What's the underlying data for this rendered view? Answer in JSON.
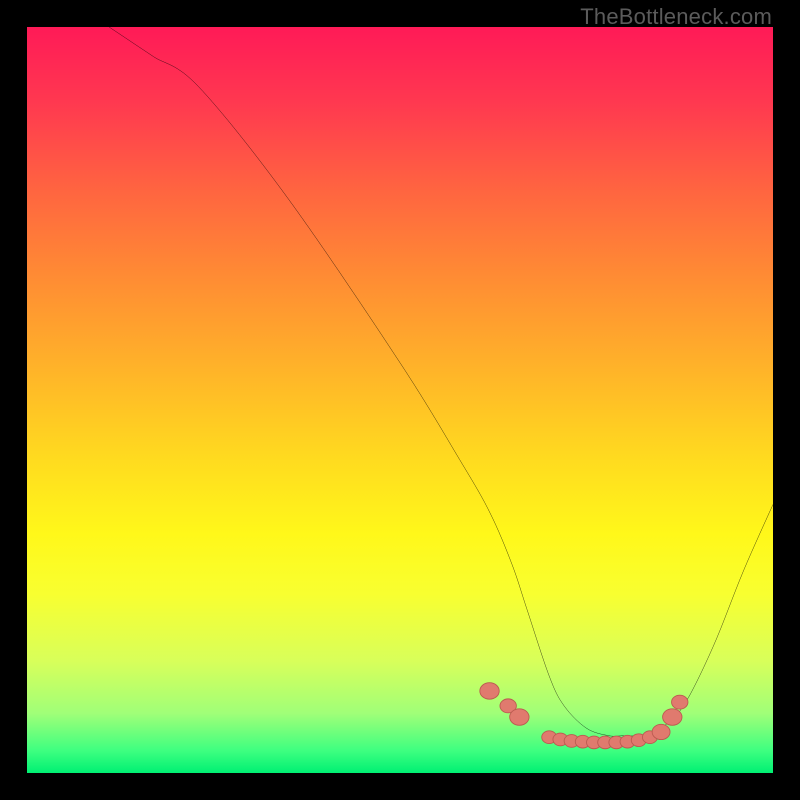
{
  "attribution": "TheBottleneck.com",
  "colors": {
    "page_bg": "#000000",
    "gradient_top": "#ff1a57",
    "gradient_bottom": "#00f073",
    "curve_stroke": "#000000",
    "marker_fill": "#e07a6e",
    "marker_stroke": "#bb5a50"
  },
  "chart_data": {
    "type": "line",
    "title": "",
    "xlabel": "",
    "ylabel": "",
    "xlim": [
      0,
      100
    ],
    "ylim": [
      0,
      100
    ],
    "grid": false,
    "legend": false,
    "series": [
      {
        "name": "bottleneck-curve",
        "x": [
          11,
          14,
          17,
          23,
          35,
          50,
          58,
          62,
          65,
          67,
          70,
          72,
          75,
          78,
          80,
          82,
          84,
          85,
          88,
          92,
          96,
          100
        ],
        "y": [
          100,
          98,
          96,
          92,
          77,
          55,
          42,
          35,
          28,
          22,
          13,
          9,
          6,
          5,
          5,
          5,
          5.5,
          6,
          9,
          17,
          27,
          36
        ]
      }
    ],
    "markers": [
      {
        "x": 62.0,
        "y": 11.0,
        "r": 1.3
      },
      {
        "x": 64.5,
        "y": 9.0,
        "r": 1.1
      },
      {
        "x": 66.0,
        "y": 7.5,
        "r": 1.3
      },
      {
        "x": 70.0,
        "y": 4.8,
        "r": 1.0
      },
      {
        "x": 71.5,
        "y": 4.5,
        "r": 1.0
      },
      {
        "x": 73.0,
        "y": 4.3,
        "r": 1.0
      },
      {
        "x": 74.5,
        "y": 4.2,
        "r": 1.0
      },
      {
        "x": 76.0,
        "y": 4.1,
        "r": 1.0
      },
      {
        "x": 77.5,
        "y": 4.1,
        "r": 1.0
      },
      {
        "x": 79.0,
        "y": 4.1,
        "r": 1.0
      },
      {
        "x": 80.5,
        "y": 4.2,
        "r": 1.0
      },
      {
        "x": 82.0,
        "y": 4.4,
        "r": 1.0
      },
      {
        "x": 83.5,
        "y": 4.8,
        "r": 1.0
      },
      {
        "x": 85.0,
        "y": 5.5,
        "r": 1.2
      },
      {
        "x": 86.5,
        "y": 7.5,
        "r": 1.3
      },
      {
        "x": 87.5,
        "y": 9.5,
        "r": 1.1
      }
    ]
  }
}
